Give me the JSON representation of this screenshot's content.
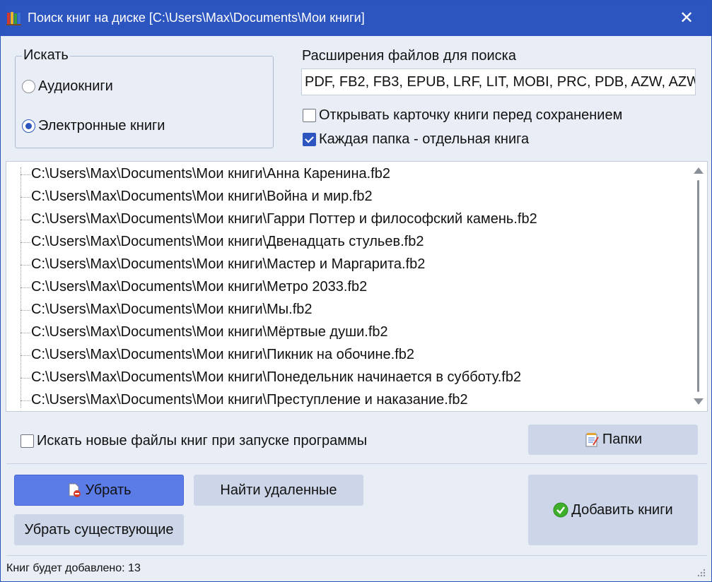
{
  "window": {
    "title": "Поиск книг на диске [C:\\Users\\Max\\Documents\\Мои книги]",
    "close_icon": "close-icon"
  },
  "search_group": {
    "legend": "Искать",
    "options": [
      {
        "label": "Аудиокниги",
        "selected": false
      },
      {
        "label": "Электронные книги",
        "selected": true
      }
    ]
  },
  "extensions": {
    "label": "Расширения файлов для поиска",
    "value": "PDF, FB2, FB3, EPUB, LRF, LIT, MOBI, PRC, PDB, AZW, AZW"
  },
  "options": {
    "open_card": {
      "label": "Открывать карточку книги перед сохранением",
      "checked": false
    },
    "folder_is_book": {
      "label": "Каждая папка - отдельная книга",
      "checked": true
    }
  },
  "files": [
    "C:\\Users\\Max\\Documents\\Мои книги\\Анна Каренина.fb2",
    "C:\\Users\\Max\\Documents\\Мои книги\\Война и мир.fb2",
    "C:\\Users\\Max\\Documents\\Мои книги\\Гарри Поттер и философский камень.fb2",
    "C:\\Users\\Max\\Documents\\Мои книги\\Двенадцать стульев.fb2",
    "C:\\Users\\Max\\Documents\\Мои книги\\Мастер и Маргарита.fb2",
    "C:\\Users\\Max\\Documents\\Мои книги\\Метро 2033.fb2",
    "C:\\Users\\Max\\Documents\\Мои книги\\Мы.fb2",
    "C:\\Users\\Max\\Documents\\Мои книги\\Мёртвые души.fb2",
    "C:\\Users\\Max\\Documents\\Мои книги\\Пикник на обочине.fb2",
    "C:\\Users\\Max\\Documents\\Мои книги\\Понедельник начинается в субботу.fb2",
    "C:\\Users\\Max\\Documents\\Мои книги\\Преступление и наказание.fb2"
  ],
  "startup_scan": {
    "label": "Искать новые файлы книг при запуске программы",
    "checked": false
  },
  "buttons": {
    "folders": "Папки",
    "remove": "Убрать",
    "find_deleted": "Найти удаленные",
    "remove_existing": "Убрать существующие",
    "add_books": "Добавить книги"
  },
  "status": {
    "text": "Книг будет добавлено: 13"
  },
  "colors": {
    "titlebar": "#2c55c0",
    "window_bg": "#e9eef6",
    "button": "#ccd6e8",
    "primary_button": "#5b7be6",
    "ok_green": "#3fae2a"
  }
}
